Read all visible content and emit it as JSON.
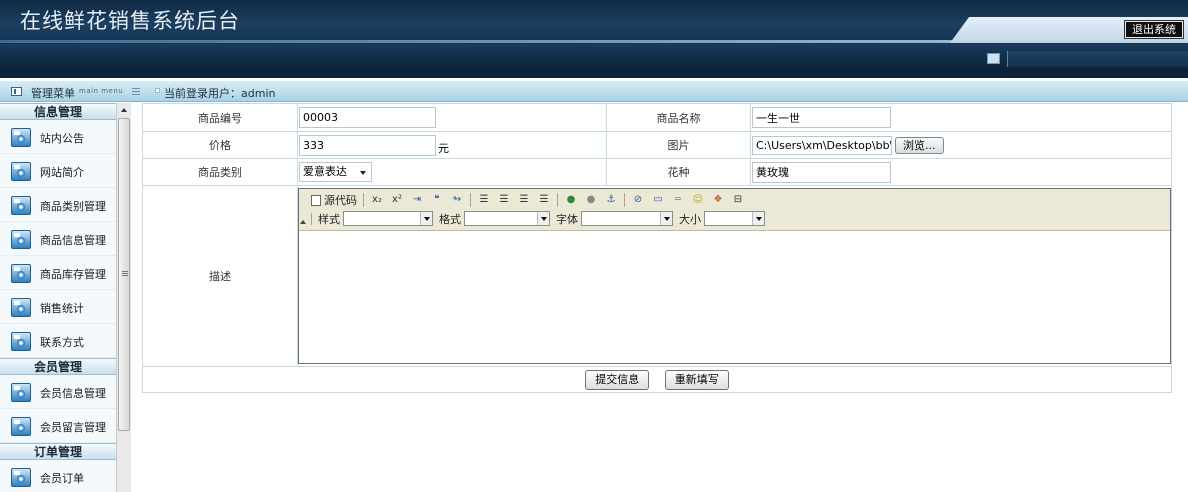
{
  "header": {
    "title": "在线鲜花销售系统后台",
    "logout_label": "退出系统"
  },
  "strip": {
    "menu_label": "管理菜单",
    "menu_sub": "main menu",
    "current_user": "当前登录用户：admin"
  },
  "sidebar": {
    "groups": [
      {
        "title": "信息管理",
        "items": [
          "站内公告",
          "网站简介",
          "商品类别管理",
          "商品信息管理",
          "商品库存管理",
          "销售统计",
          "联系方式"
        ]
      },
      {
        "title": "会员管理",
        "items": [
          "会员信息管理",
          "会员留言管理"
        ]
      },
      {
        "title": "订单管理",
        "items": [
          "会员订单"
        ]
      }
    ]
  },
  "form": {
    "code_label": "商品编号",
    "code_value": "00003",
    "name_label": "商品名称",
    "name_value": "一生一世",
    "price_label": "价格",
    "price_value": "333",
    "price_unit": "元",
    "image_label": "图片",
    "image_value": "C:\\Users\\xm\\Desktop\\bb\\(",
    "browse_label": "浏览...",
    "category_label": "商品类别",
    "category_value": "爱意表达",
    "variety_label": "花种",
    "variety_value": "黄玫瑰",
    "desc_label": "描述"
  },
  "editor": {
    "source_label": "源代码",
    "style_label": "样式",
    "format_label": "格式",
    "font_label": "字体",
    "size_label": "大小"
  },
  "actions": {
    "submit_label": "提交信息",
    "reset_label": "重新填写"
  }
}
